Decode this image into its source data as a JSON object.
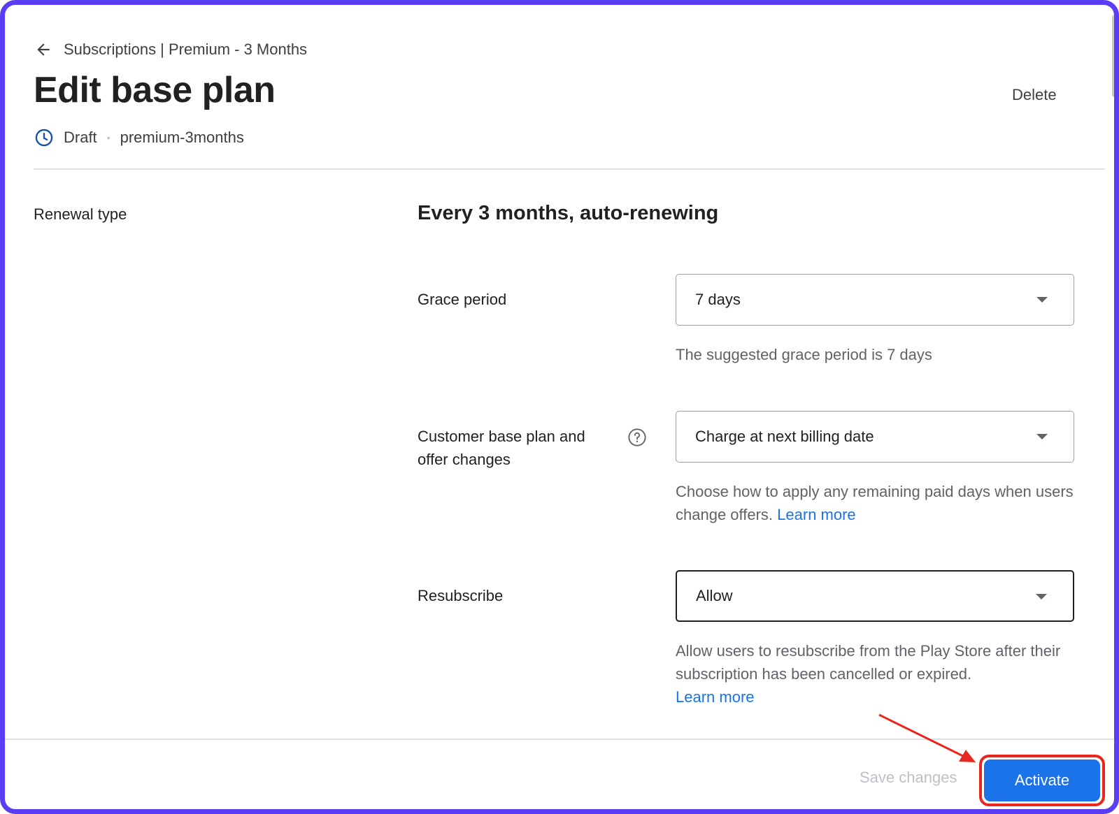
{
  "header": {
    "breadcrumb": "Subscriptions | Premium - 3 Months",
    "title": "Edit base plan",
    "delete_label": "Delete",
    "status": "Draft",
    "plan_id": "premium-3months"
  },
  "renewal": {
    "label": "Renewal type",
    "value": "Every 3 months, auto-renewing"
  },
  "fields": {
    "grace_period": {
      "label": "Grace period",
      "value": "7 days",
      "helper": "The suggested grace period is 7 days"
    },
    "offer_changes": {
      "label_line1": "Customer base plan and",
      "label_line2": "offer changes",
      "value": "Charge at next billing date",
      "helper": "Choose how to apply any remaining paid days when users change offers.",
      "link": "Learn more"
    },
    "resubscribe": {
      "label": "Resubscribe",
      "value": "Allow",
      "helper": "Allow users to resubscribe from the Play Store after their subscription has been cancelled or expired.",
      "link": "Learn more"
    }
  },
  "footer": {
    "save_label": "Save changes",
    "activate_label": "Activate"
  },
  "colors": {
    "frame": "#5b3df5",
    "primary": "#1a73e8",
    "annotation": "#e8281e"
  }
}
